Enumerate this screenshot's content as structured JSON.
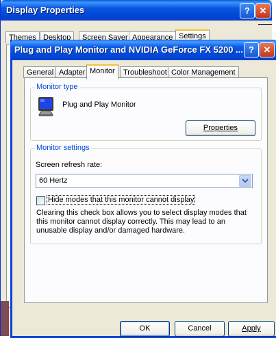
{
  "back_window": {
    "title": "Display Properties",
    "help_glyph": "?",
    "close_glyph": "✕",
    "tabs": [
      "Themes",
      "Desktop",
      "Screen Saver",
      "Appearance",
      "Settings"
    ]
  },
  "dialog": {
    "title": "Plug and Play Monitor and NVIDIA GeForce FX 5200  ...",
    "help_glyph": "?",
    "close_glyph": "✕",
    "tabs": [
      "General",
      "Adapter",
      "Monitor",
      "Troubleshoot",
      "Color Management"
    ],
    "active_tab": "Monitor",
    "monitor_type": {
      "group_label": "Monitor type",
      "monitor_name": "Plug and Play Monitor",
      "properties_button": "Properties"
    },
    "monitor_settings": {
      "group_label": "Monitor settings",
      "refresh_label": "Screen refresh rate:",
      "refresh_value": "60 Hertz",
      "hide_modes_checked": false,
      "hide_modes_label": "Hide modes that this monitor cannot display",
      "description": "Clearing this check box allows you to select display modes that this monitor cannot display correctly. This may lead to an unusable display and/or damaged hardware."
    },
    "buttons": {
      "ok": "OK",
      "cancel": "Cancel",
      "apply": "Apply"
    }
  },
  "colors": {
    "title_bar": "#0047d8",
    "group_label": "#0046d5",
    "dialog_face": "#ece9d8",
    "tab_highlight": "#f5c040"
  },
  "icons": {
    "monitor": "crt-monitor-icon",
    "dropdown": "chevron-down-icon"
  }
}
